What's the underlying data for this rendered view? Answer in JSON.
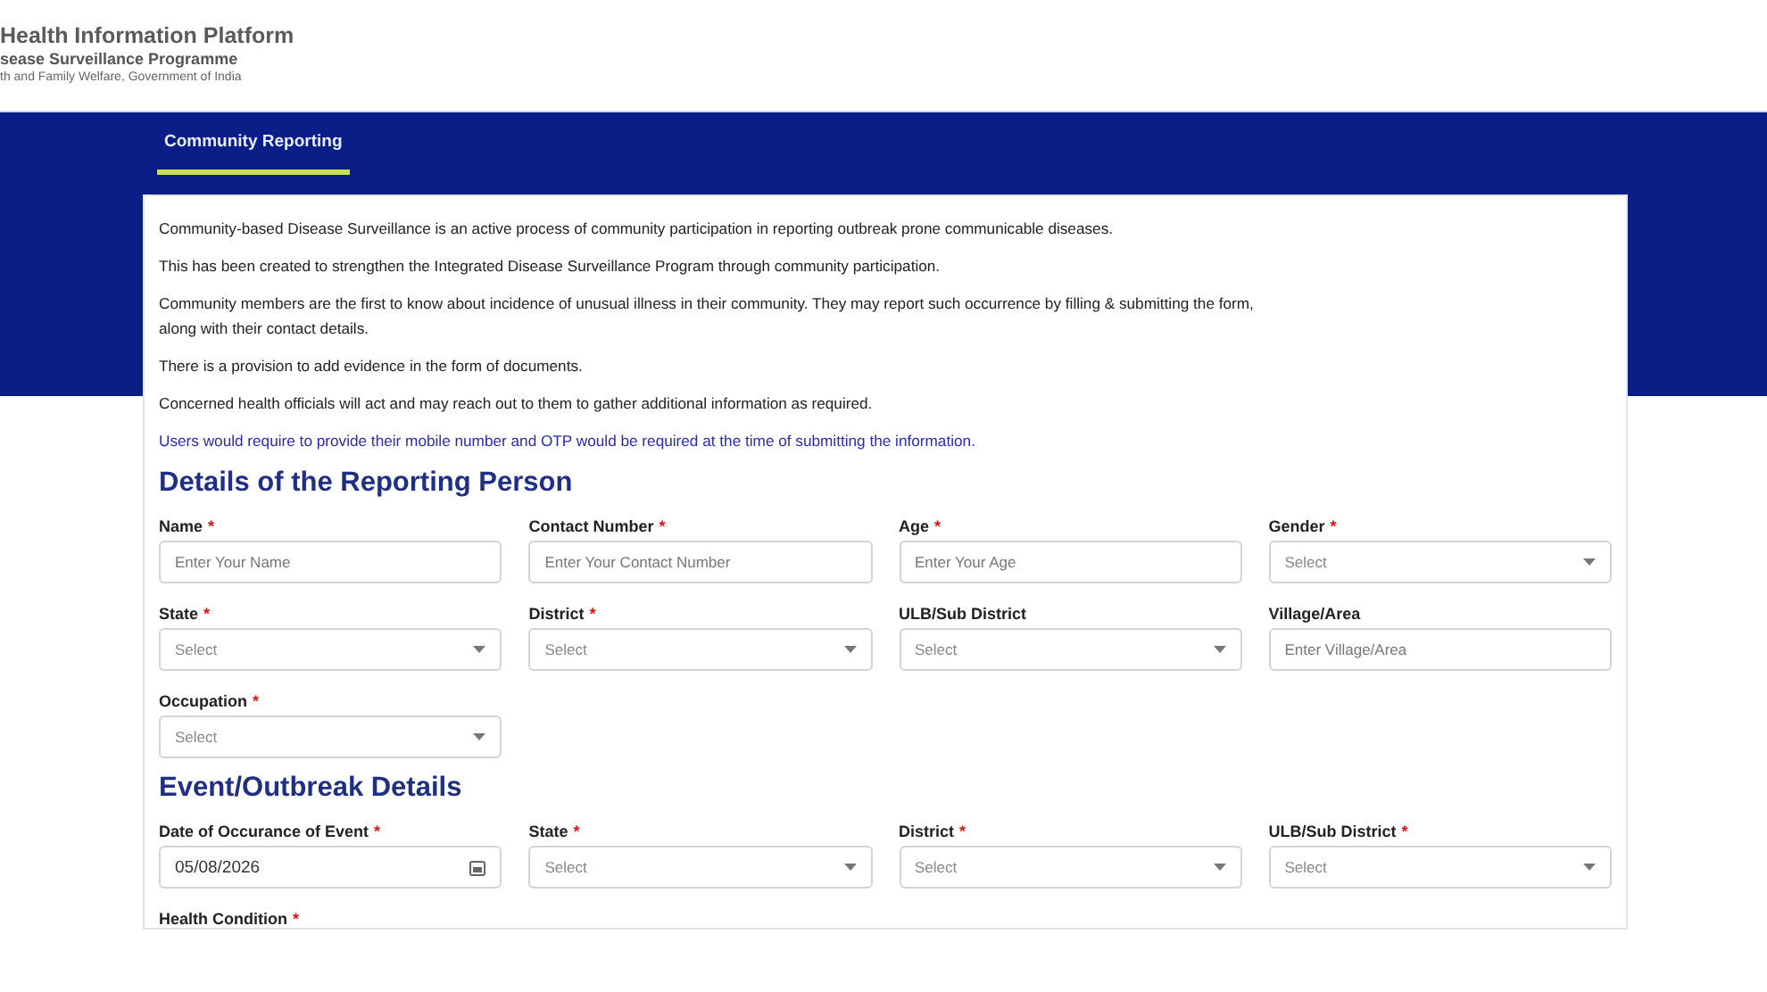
{
  "header": {
    "title": "Health Information Platform",
    "subtitle": "sease Surveillance Programme",
    "ministry": "th and Family Welfare, Government of India"
  },
  "tabs": [
    {
      "label": "Community Reporting",
      "selected": true
    }
  ],
  "intro": [
    {
      "text": "Community-based Disease Surveillance is an active process of community participation in reporting outbreak prone communicable diseases.",
      "kind": "plain"
    },
    {
      "text": "This has been created to strengthen the Integrated Disease Surveillance Program through community participation.",
      "kind": "plain"
    },
    {
      "text": "Community members are the first to know about incidence of unusual illness in their community. They may report such occurrence by filling & submitting the form, along with their contact details.",
      "kind": "plain"
    },
    {
      "text": "There is a provision to add evidence in the form of documents.",
      "kind": "plain"
    },
    {
      "text": "Concerned health officials will act and may reach out to them to gather additional information as required.",
      "kind": "plain"
    },
    {
      "text": "Users would require to provide their mobile number and OTP would be required at the time of submitting the information.",
      "kind": "notice"
    }
  ],
  "sections": [
    {
      "title": "Details of the Reporting Person",
      "fields": [
        {
          "label": "Name",
          "mark": "*",
          "kind": "text",
          "placeholder": "Enter Your Name"
        },
        {
          "label": "Contact Number",
          "mark": "*",
          "kind": "text",
          "placeholder": "Enter Your Contact Number"
        },
        {
          "label": "Age",
          "mark": "*",
          "kind": "text",
          "placeholder": "Enter Your Age"
        },
        {
          "label": "Gender",
          "mark": "*",
          "kind": "select",
          "placeholder": "Select"
        },
        {
          "label": "State",
          "mark": "*",
          "kind": "select",
          "placeholder": "Select"
        },
        {
          "label": "District",
          "mark": "*",
          "kind": "select",
          "placeholder": "Select"
        },
        {
          "label": "ULB/Sub District",
          "kind": "select",
          "placeholder": "Select"
        },
        {
          "label": "Village/Area",
          "kind": "text",
          "placeholder": "Enter Village/Area"
        },
        {
          "label": "Occupation",
          "mark": "*",
          "kind": "select",
          "placeholder": "Select"
        }
      ]
    },
    {
      "title": "Event/Outbreak Details",
      "fields": [
        {
          "label": "Date of Occurance of Event",
          "mark": "*",
          "kind": "date",
          "value": "05/08/2026"
        },
        {
          "label": "State",
          "mark": "*",
          "kind": "select",
          "placeholder": "Select"
        },
        {
          "label": "District",
          "mark": "*",
          "kind": "select",
          "placeholder": "Select"
        },
        {
          "label": "ULB/Sub District",
          "mark": "*",
          "kind": "select",
          "placeholder": "Select"
        },
        {
          "label": "Health Condition",
          "mark": "*",
          "kind": "label"
        }
      ]
    }
  ]
}
